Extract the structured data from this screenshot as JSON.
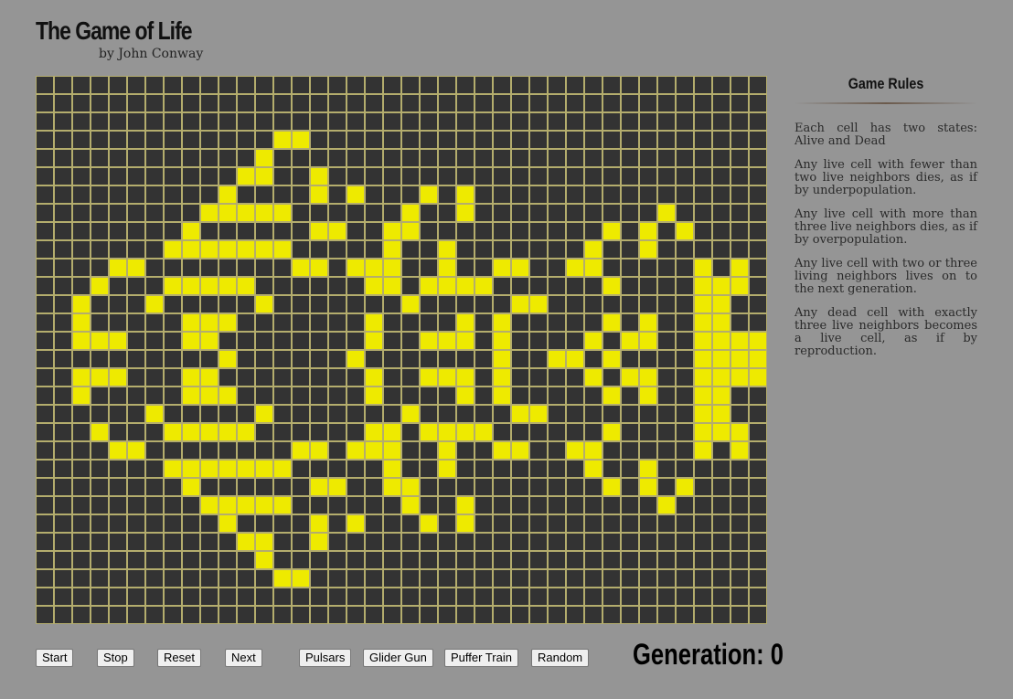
{
  "header": {
    "title": "The Game of Life",
    "byline": "by John Conway"
  },
  "rules": {
    "heading": "Game Rules",
    "items": [
      "Each cell has two states: Alive and Dead",
      "Any live cell with fewer than two live neighbors dies, as if by underpopulation.",
      "Any live cell with more than three live neighbors dies, as if by overpopulation.",
      "Any live cell with two or three living neighbors lives on to the next generation.",
      "Any dead cell with exactly three live neighbors becomes a live cell, as if by reproduction."
    ]
  },
  "controls": {
    "start": "Start",
    "stop": "Stop",
    "reset": "Reset",
    "next": "Next",
    "pulsars": "Pulsars",
    "glider_gun": "Glider Gun",
    "puffer_train": "Puffer Train",
    "random": "Random"
  },
  "status": {
    "generation_label": "Generation:",
    "generation_value": 0,
    "generation_text": "Generation: 0"
  },
  "colors": {
    "alive": "#eeea00",
    "dead": "#333333",
    "grid": "#b4ad6d"
  },
  "board": {
    "cols": 40,
    "rows": 30,
    "alive_cells": [
      [
        3,
        13
      ],
      [
        3,
        14
      ],
      [
        4,
        12
      ],
      [
        5,
        11
      ],
      [
        5,
        12
      ],
      [
        5,
        15
      ],
      [
        6,
        10
      ],
      [
        6,
        15
      ],
      [
        6,
        17
      ],
      [
        6,
        21
      ],
      [
        6,
        23
      ],
      [
        7,
        9
      ],
      [
        7,
        10
      ],
      [
        7,
        11
      ],
      [
        7,
        12
      ],
      [
        7,
        13
      ],
      [
        7,
        20
      ],
      [
        7,
        23
      ],
      [
        7,
        34
      ],
      [
        8,
        8
      ],
      [
        8,
        15
      ],
      [
        8,
        16
      ],
      [
        8,
        19
      ],
      [
        8,
        20
      ],
      [
        8,
        31
      ],
      [
        8,
        33
      ],
      [
        8,
        35
      ],
      [
        9,
        7
      ],
      [
        9,
        8
      ],
      [
        9,
        9
      ],
      [
        9,
        10
      ],
      [
        9,
        11
      ],
      [
        9,
        12
      ],
      [
        9,
        13
      ],
      [
        9,
        19
      ],
      [
        9,
        22
      ],
      [
        9,
        30
      ],
      [
        9,
        33
      ],
      [
        10,
        4
      ],
      [
        10,
        5
      ],
      [
        10,
        14
      ],
      [
        10,
        15
      ],
      [
        10,
        17
      ],
      [
        10,
        18
      ],
      [
        10,
        19
      ],
      [
        10,
        22
      ],
      [
        10,
        25
      ],
      [
        10,
        26
      ],
      [
        10,
        29
      ],
      [
        10,
        30
      ],
      [
        10,
        36
      ],
      [
        10,
        38
      ],
      [
        11,
        3
      ],
      [
        11,
        7
      ],
      [
        11,
        8
      ],
      [
        11,
        9
      ],
      [
        11,
        10
      ],
      [
        11,
        11
      ],
      [
        11,
        18
      ],
      [
        11,
        19
      ],
      [
        11,
        21
      ],
      [
        11,
        22
      ],
      [
        11,
        23
      ],
      [
        11,
        24
      ],
      [
        11,
        31
      ],
      [
        11,
        36
      ],
      [
        11,
        37
      ],
      [
        11,
        38
      ],
      [
        12,
        2
      ],
      [
        12,
        6
      ],
      [
        12,
        12
      ],
      [
        12,
        20
      ],
      [
        12,
        26
      ],
      [
        12,
        27
      ],
      [
        12,
        36
      ],
      [
        12,
        37
      ],
      [
        13,
        2
      ],
      [
        13,
        8
      ],
      [
        13,
        9
      ],
      [
        13,
        10
      ],
      [
        13,
        18
      ],
      [
        13,
        23
      ],
      [
        13,
        25
      ],
      [
        13,
        31
      ],
      [
        13,
        33
      ],
      [
        13,
        36
      ],
      [
        13,
        37
      ],
      [
        14,
        2
      ],
      [
        14,
        3
      ],
      [
        14,
        4
      ],
      [
        14,
        8
      ],
      [
        14,
        9
      ],
      [
        14,
        18
      ],
      [
        14,
        21
      ],
      [
        14,
        22
      ],
      [
        14,
        23
      ],
      [
        14,
        25
      ],
      [
        14,
        30
      ],
      [
        14,
        32
      ],
      [
        14,
        33
      ],
      [
        14,
        36
      ],
      [
        14,
        37
      ],
      [
        14,
        38
      ],
      [
        14,
        39
      ],
      [
        15,
        10
      ],
      [
        15,
        17
      ],
      [
        15,
        25
      ],
      [
        15,
        28
      ],
      [
        15,
        29
      ],
      [
        15,
        31
      ],
      [
        15,
        36
      ],
      [
        15,
        37
      ],
      [
        15,
        38
      ],
      [
        15,
        39
      ],
      [
        16,
        2
      ],
      [
        16,
        3
      ],
      [
        16,
        4
      ],
      [
        16,
        8
      ],
      [
        16,
        9
      ],
      [
        16,
        18
      ],
      [
        16,
        21
      ],
      [
        16,
        22
      ],
      [
        16,
        23
      ],
      [
        16,
        25
      ],
      [
        16,
        30
      ],
      [
        16,
        32
      ],
      [
        16,
        33
      ],
      [
        16,
        36
      ],
      [
        16,
        37
      ],
      [
        16,
        38
      ],
      [
        16,
        39
      ],
      [
        17,
        2
      ],
      [
        17,
        8
      ],
      [
        17,
        9
      ],
      [
        17,
        10
      ],
      [
        17,
        18
      ],
      [
        17,
        23
      ],
      [
        17,
        25
      ],
      [
        17,
        31
      ],
      [
        17,
        33
      ],
      [
        17,
        36
      ],
      [
        17,
        37
      ],
      [
        18,
        6
      ],
      [
        18,
        12
      ],
      [
        18,
        20
      ],
      [
        18,
        26
      ],
      [
        18,
        27
      ],
      [
        18,
        36
      ],
      [
        18,
        37
      ],
      [
        19,
        3
      ],
      [
        19,
        7
      ],
      [
        19,
        8
      ],
      [
        19,
        9
      ],
      [
        19,
        10
      ],
      [
        19,
        11
      ],
      [
        19,
        18
      ],
      [
        19,
        19
      ],
      [
        19,
        21
      ],
      [
        19,
        22
      ],
      [
        19,
        23
      ],
      [
        19,
        24
      ],
      [
        19,
        31
      ],
      [
        19,
        36
      ],
      [
        19,
        37
      ],
      [
        19,
        38
      ],
      [
        20,
        4
      ],
      [
        20,
        5
      ],
      [
        20,
        14
      ],
      [
        20,
        15
      ],
      [
        20,
        17
      ],
      [
        20,
        18
      ],
      [
        20,
        19
      ],
      [
        20,
        22
      ],
      [
        20,
        25
      ],
      [
        20,
        26
      ],
      [
        20,
        29
      ],
      [
        20,
        30
      ],
      [
        20,
        36
      ],
      [
        20,
        38
      ],
      [
        21,
        7
      ],
      [
        21,
        8
      ],
      [
        21,
        9
      ],
      [
        21,
        10
      ],
      [
        21,
        11
      ],
      [
        21,
        12
      ],
      [
        21,
        13
      ],
      [
        21,
        19
      ],
      [
        21,
        22
      ],
      [
        21,
        30
      ],
      [
        21,
        33
      ],
      [
        22,
        8
      ],
      [
        22,
        15
      ],
      [
        22,
        16
      ],
      [
        22,
        19
      ],
      [
        22,
        20
      ],
      [
        22,
        31
      ],
      [
        22,
        33
      ],
      [
        22,
        35
      ],
      [
        23,
        9
      ],
      [
        23,
        10
      ],
      [
        23,
        11
      ],
      [
        23,
        12
      ],
      [
        23,
        13
      ],
      [
        23,
        20
      ],
      [
        23,
        23
      ],
      [
        23,
        34
      ],
      [
        24,
        10
      ],
      [
        24,
        15
      ],
      [
        24,
        17
      ],
      [
        24,
        21
      ],
      [
        24,
        23
      ],
      [
        25,
        11
      ],
      [
        25,
        12
      ],
      [
        25,
        15
      ],
      [
        26,
        12
      ],
      [
        27,
        13
      ],
      [
        27,
        14
      ]
    ]
  }
}
